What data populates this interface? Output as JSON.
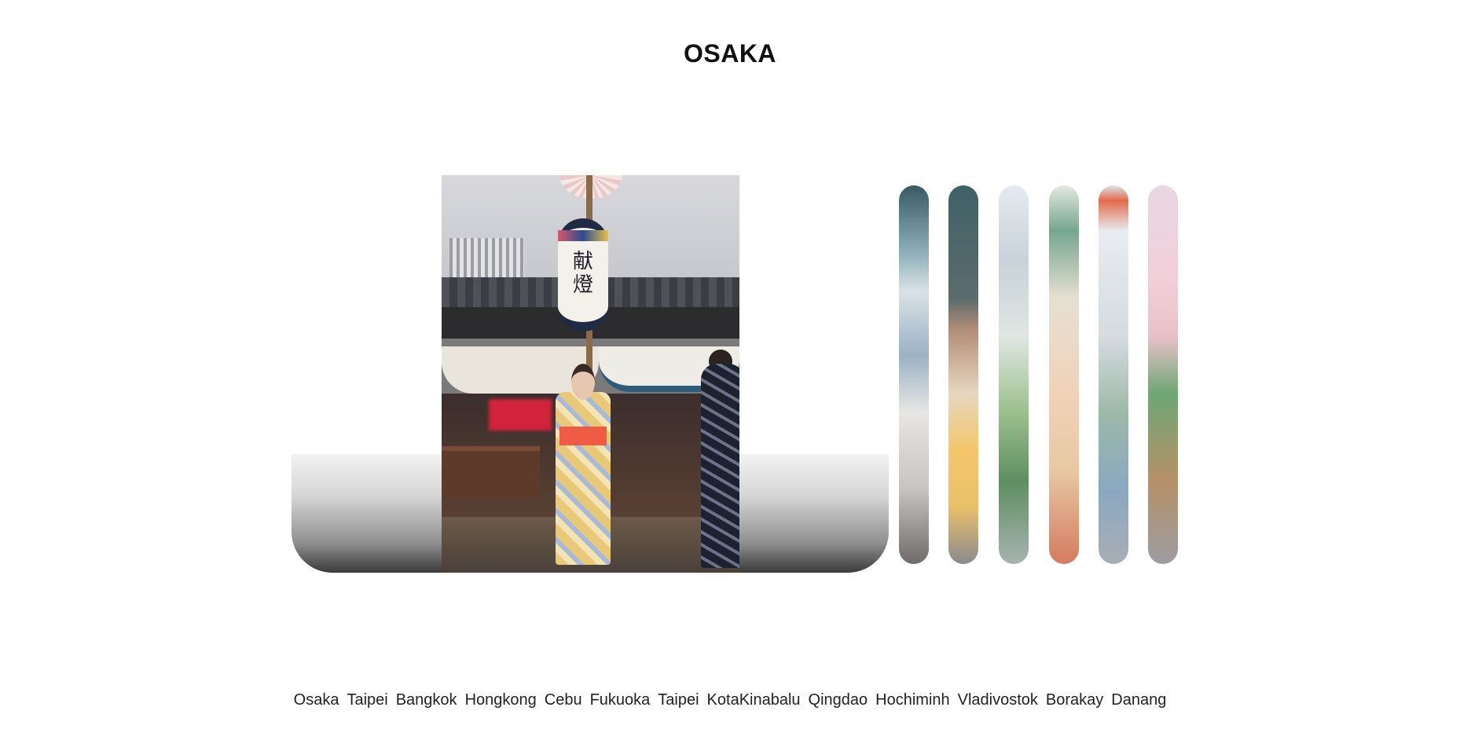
{
  "header": {
    "title": "OSAKA"
  },
  "feature": {
    "lantern_text": "献燈"
  },
  "strips": [
    {
      "name": "strip-1"
    },
    {
      "name": "strip-2"
    },
    {
      "name": "strip-3"
    },
    {
      "name": "strip-4"
    },
    {
      "name": "strip-5"
    },
    {
      "name": "strip-6"
    }
  ],
  "nav": {
    "items": [
      "Osaka",
      "Taipei",
      "Bangkok",
      "Hongkong",
      "Cebu",
      "Fukuoka",
      "Taipei",
      "KotaKinabalu",
      "Qingdao",
      "Hochiminh",
      "Vladivostok",
      "Borakay",
      "Danang"
    ]
  }
}
